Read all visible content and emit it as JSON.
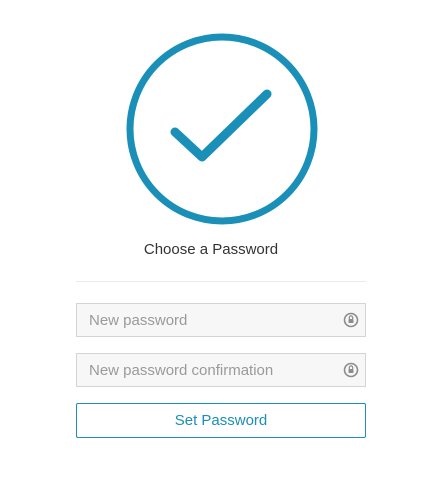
{
  "colors": {
    "accent": "#1a8fb8",
    "title_text": "#333333",
    "placeholder_text": "#9a9a9a",
    "field_background": "#f7f7f7",
    "field_border": "#d4d4d4",
    "divider": "#eaeaea"
  },
  "hero": {
    "icon": "check-circle-icon"
  },
  "title": "Choose a Password",
  "form": {
    "new_password": {
      "placeholder": "New password",
      "value": "",
      "icon": "reveal-password-icon"
    },
    "confirm_password": {
      "placeholder": "New password confirmation",
      "value": "",
      "icon": "reveal-password-icon"
    },
    "submit_label": "Set Password"
  }
}
